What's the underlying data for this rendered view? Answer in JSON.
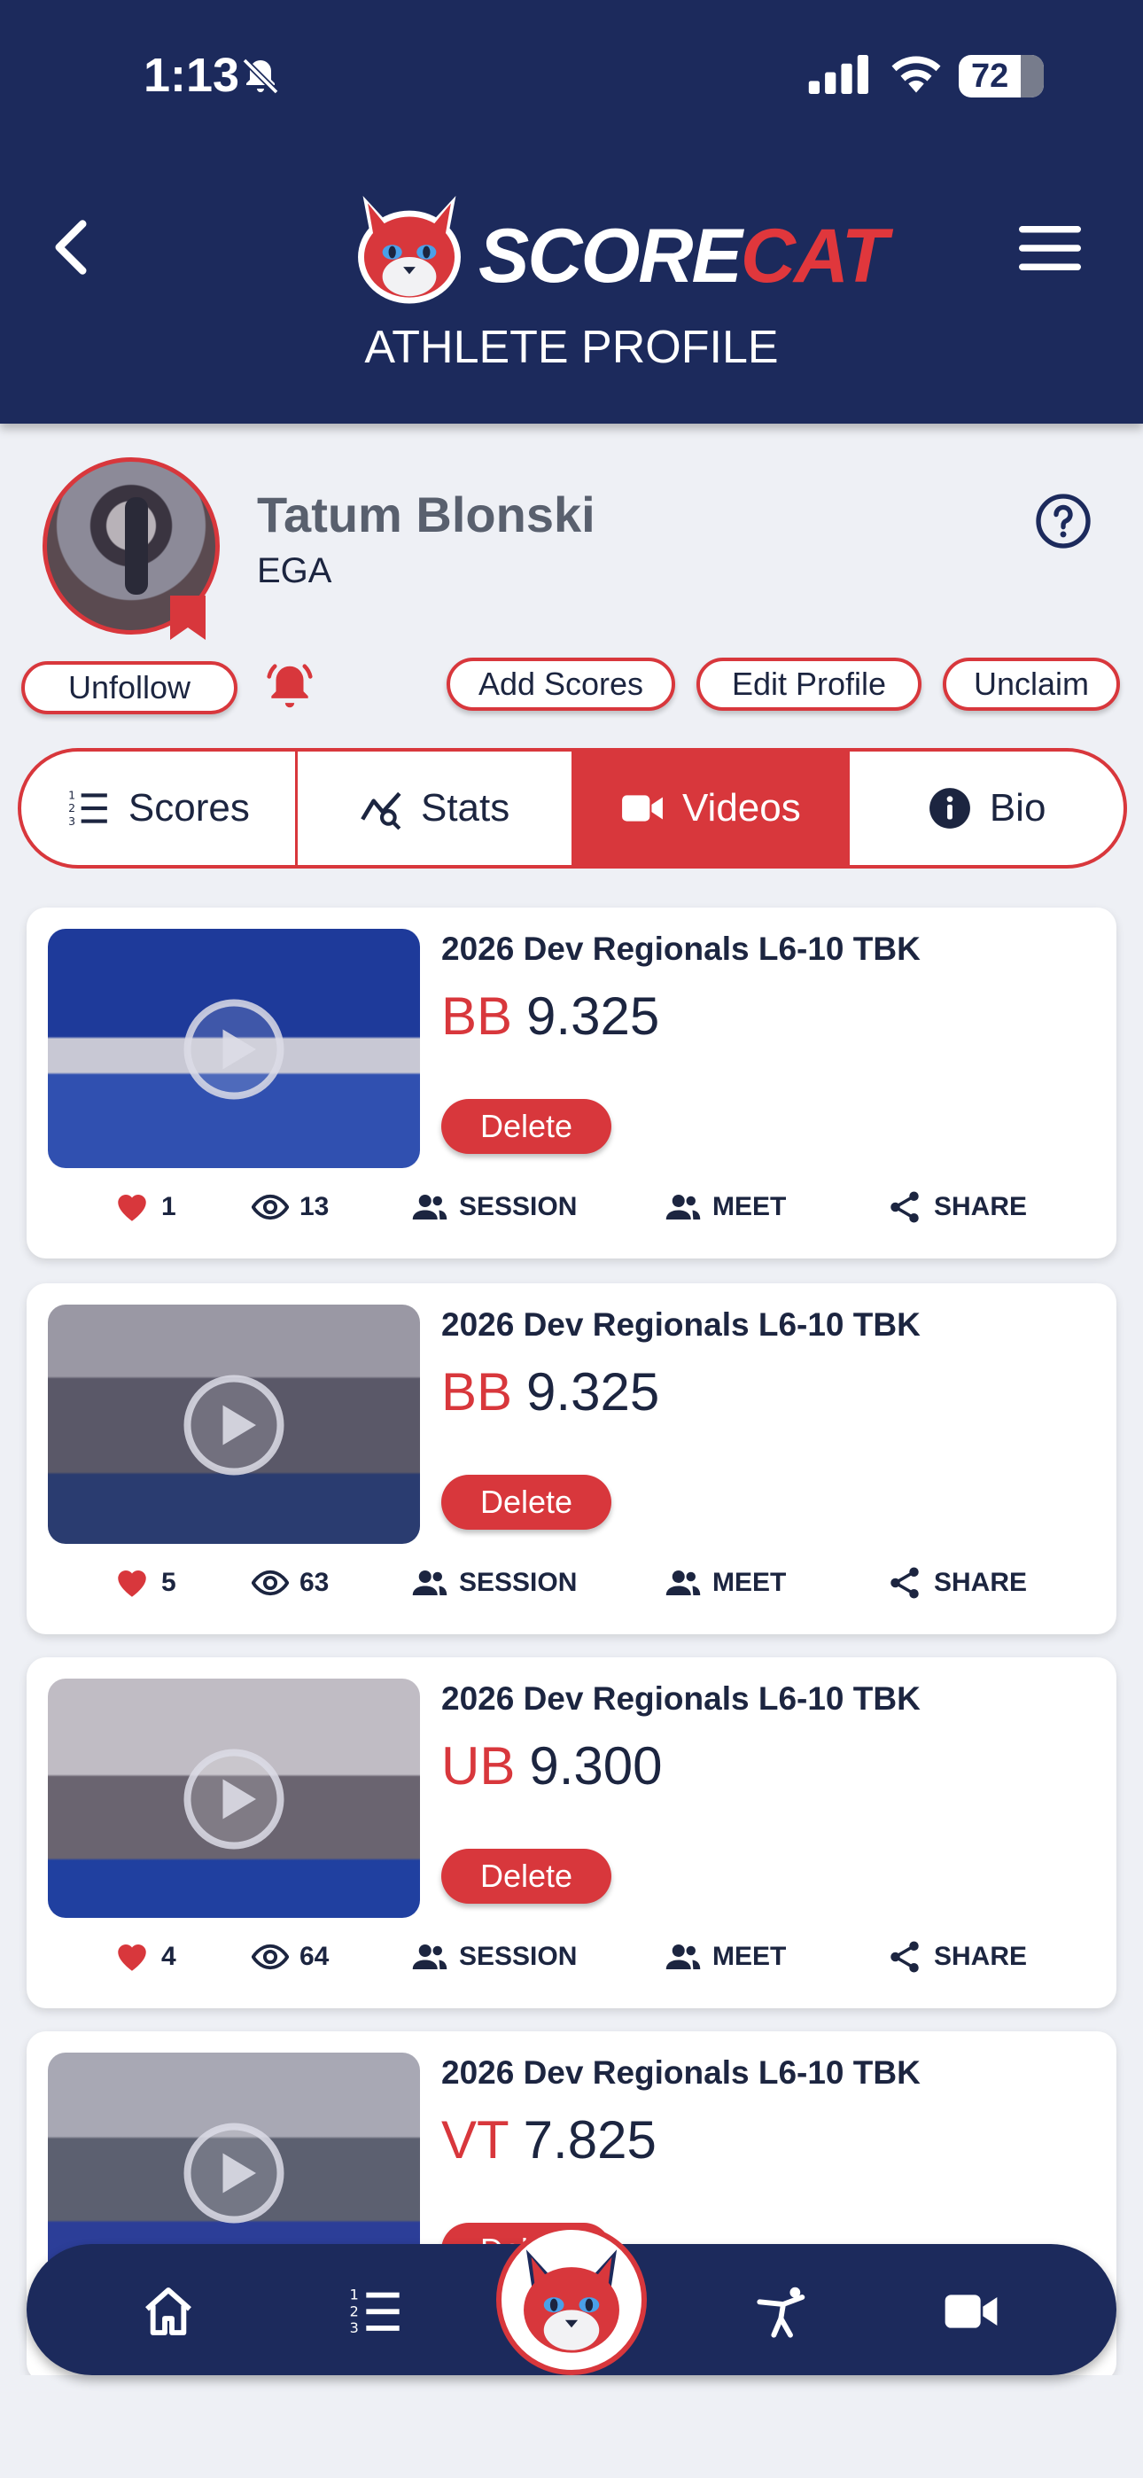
{
  "status_bar": {
    "time": "1:13",
    "battery": "72"
  },
  "header": {
    "logo_part1": "SCORE",
    "logo_part2": "CAT",
    "title": "ATHLETE PROFILE"
  },
  "profile": {
    "name": "Tatum Blonski",
    "club": "EGA"
  },
  "buttons": {
    "unfollow": "Unfollow",
    "add_scores": "Add Scores",
    "edit_profile": "Edit Profile",
    "unclaim": "Unclaim"
  },
  "tabs": [
    {
      "label": "Scores",
      "active": false
    },
    {
      "label": "Stats",
      "active": false
    },
    {
      "label": "Videos",
      "active": true
    },
    {
      "label": "Bio",
      "active": false
    }
  ],
  "videos": [
    {
      "meet": "2026 Dev Regionals L6-10 TBK",
      "event": "BB",
      "score": "9.325",
      "delete": "Delete",
      "likes": "1",
      "views": "13",
      "session": "SESSION",
      "meet_label": "MEET",
      "share": "SHARE"
    },
    {
      "meet": "2026 Dev Regionals L6-10 TBK",
      "event": "BB",
      "score": "9.325",
      "delete": "Delete",
      "likes": "5",
      "views": "63",
      "session": "SESSION",
      "meet_label": "MEET",
      "share": "SHARE"
    },
    {
      "meet": "2026 Dev Regionals L6-10 TBK",
      "event": "UB",
      "score": "9.300",
      "delete": "Delete",
      "likes": "4",
      "views": "64",
      "session": "SESSION",
      "meet_label": "MEET",
      "share": "SHARE"
    },
    {
      "meet": "2026 Dev Regionals L6-10 TBK",
      "event": "VT",
      "score": "7.825",
      "delete": "Delete"
    }
  ],
  "colors": {
    "navy": "#1c2a5c",
    "accent_red": "#d8373c"
  }
}
